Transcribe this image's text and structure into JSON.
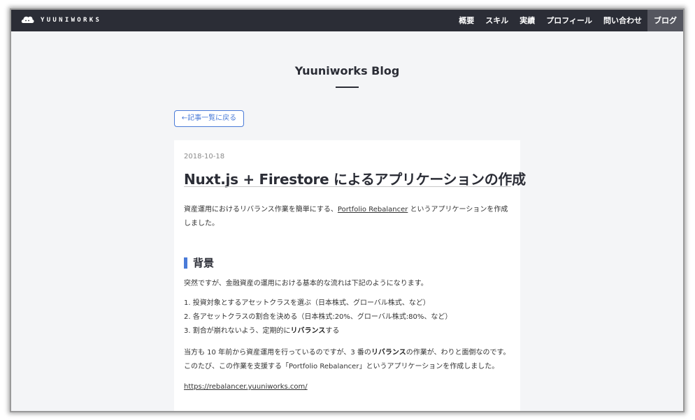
{
  "brand": {
    "logo_icon": "cloud-logo-icon",
    "name": "YUUNIWORKS"
  },
  "nav": {
    "items": [
      {
        "label": "概要"
      },
      {
        "label": "スキル"
      },
      {
        "label": "実績"
      },
      {
        "label": "プロフィール"
      },
      {
        "label": "問い合わせ"
      },
      {
        "label": "ブログ",
        "active": true
      }
    ]
  },
  "blog": {
    "title": "Yuuniworks Blog",
    "back_label": "←記事一覧に戻る"
  },
  "post": {
    "date": "2018-10-18",
    "title": "Nuxt.js + Firestore によるアプリケーションの作成",
    "intro_before": "資産運用におけるリバランス作業を簡単にする、",
    "intro_link": "Portfolio Rebalancer",
    "intro_after": " というアプリケーションを作成しました。",
    "section_title": "背景",
    "para1": "突然ですが、金融資産の運用における基本的な流れは下記のようになります。",
    "list": [
      {
        "text": "1. 投資対象とするアセットクラスを選ぶ（日本株式、グローバル株式、など）"
      },
      {
        "text": "2. 各アセットクラスの割合を決める（日本株式:20%、グローバル株式:80%、など）"
      },
      {
        "text_before": "3. 割合が崩れないよう、定期的に",
        "bold": "リバランス",
        "text_after": "する"
      }
    ],
    "para2_before": "当方も 10 年前から資産運用を行っているのですが、3 番の",
    "para2_bold": "リバランス",
    "para2_after": "の作業が、わりと面倒なのです。",
    "para3": "このたび、この作業を支援する「Portfolio Rebalancer」というアプリケーションを作成しました。",
    "site_link": "https://rebalancer.yuuniworks.com/"
  },
  "colors": {
    "navbar": "#2b2d36",
    "accent": "#4a7bd8",
    "background": "#f4f5f7"
  }
}
